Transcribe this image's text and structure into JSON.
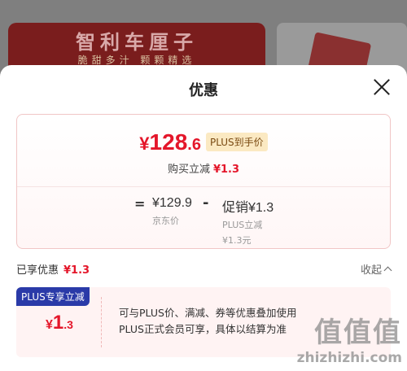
{
  "background": {
    "banner_title": "智利车厘子",
    "banner_subtitle": "脆甜多汁 颗颗精选"
  },
  "sheet": {
    "title": "优惠",
    "close_icon": "close-icon"
  },
  "price_card": {
    "final_price": {
      "currency": "¥",
      "integer": "128",
      "decimal": ".6"
    },
    "plus_tag": "PLUS到手价",
    "discount_label": "购买立减",
    "discount_amount": "¥1.3",
    "equals": "=",
    "original_price": "¥129.9",
    "original_label": "京东价",
    "minus": "-",
    "promo_value": "促销¥1.3",
    "promo_sub1": "PLUS立减",
    "promo_sub2": "¥1.3元"
  },
  "summary": {
    "enjoyed_label": "已享优惠",
    "enjoyed_amount": "¥1.3",
    "collapse_label": "收起"
  },
  "coupon": {
    "badge": "PLUS专享立减",
    "value": {
      "currency": "¥",
      "integer": "1",
      "decimal": ".3"
    },
    "desc_line1": "可与PLUS价、满减、券等优惠叠加使用",
    "desc_line2": "PLUS正式会员可享，具体以结算为准"
  },
  "watermark": {
    "logo": "值值值",
    "text": "zhizhizhi.com"
  },
  "colors": {
    "accent_red": "#e4162a",
    "plus_badge_blue": "#2a3aa8"
  }
}
